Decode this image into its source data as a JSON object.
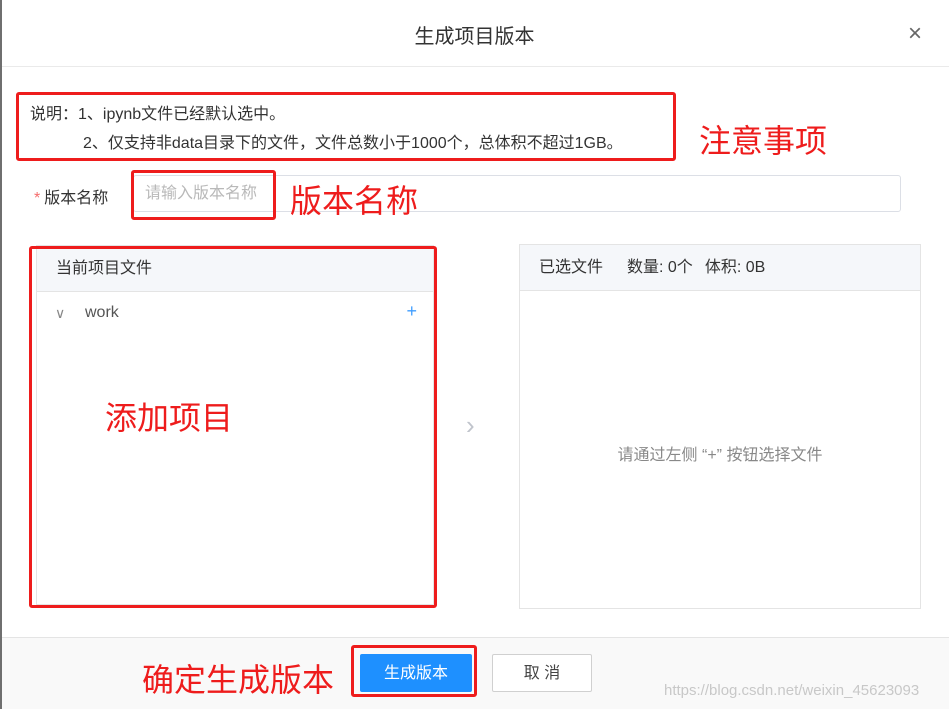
{
  "dialog": {
    "title": "生成项目版本",
    "close_icon": "×"
  },
  "notice": {
    "prefix": "说明：",
    "line1": "1、ipynb文件已经默认选中。",
    "line2": "2、仅支持非data目录下的文件，文件总数小于1000个，总体积不超过1GB。"
  },
  "version_name": {
    "required_mark": "*",
    "label": "版本名称",
    "placeholder": "请输入版本名称",
    "value": ""
  },
  "left_panel": {
    "title": "当前项目文件",
    "tree": [
      {
        "label": "work",
        "expand_icon": "∨",
        "add_icon": "+"
      }
    ]
  },
  "transfer_arrow": "›",
  "right_panel": {
    "title": "已选文件",
    "count_label": "数量: 0个",
    "size_label": "体积: 0B",
    "empty_text": "请通过左侧 “+” 按钮选择文件"
  },
  "footer": {
    "confirm_label": "生成版本",
    "cancel_label": "取 消"
  },
  "annotations": {
    "notice": "注意事项",
    "version_name": "版本名称",
    "add_project": "添加项目",
    "confirm": "确定生成版本"
  },
  "watermark": "https://blog.csdn.net/weixin_45623093",
  "colors": {
    "primary": "#1e90ff",
    "annotation_red": "#ee1c1c",
    "required": "#f56c6c"
  }
}
